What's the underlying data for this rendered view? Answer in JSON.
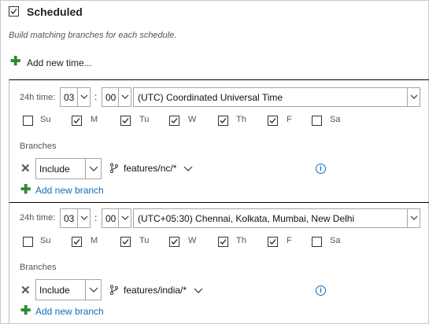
{
  "header": {
    "title": "Scheduled",
    "checked": true,
    "description": "Build matching branches for each schedule.",
    "add_time_label": "Add new time..."
  },
  "schedules": [
    {
      "time_label": "24h time:",
      "hour": "03",
      "minute": "00",
      "separator": ":",
      "timezone": "(UTC) Coordinated Universal Time",
      "days": [
        {
          "label": "Su",
          "checked": false
        },
        {
          "label": "M",
          "checked": true
        },
        {
          "label": "Tu",
          "checked": true
        },
        {
          "label": "W",
          "checked": true
        },
        {
          "label": "Th",
          "checked": true
        },
        {
          "label": "F",
          "checked": true
        },
        {
          "label": "Sa",
          "checked": false
        }
      ],
      "branches_label": "Branches",
      "filter_type": "Include",
      "branch": "features/nc/*",
      "add_branch_label": "Add new branch"
    },
    {
      "time_label": "24h time:",
      "hour": "03",
      "minute": "00",
      "separator": ":",
      "timezone": "(UTC+05:30) Chennai, Kolkata, Mumbai, New Delhi",
      "days": [
        {
          "label": "Su",
          "checked": false
        },
        {
          "label": "M",
          "checked": true
        },
        {
          "label": "Tu",
          "checked": true
        },
        {
          "label": "W",
          "checked": true
        },
        {
          "label": "Th",
          "checked": true
        },
        {
          "label": "F",
          "checked": true
        },
        {
          "label": "Sa",
          "checked": false
        }
      ],
      "branches_label": "Branches",
      "filter_type": "Include",
      "branch": "features/india/*",
      "add_branch_label": "Add new branch"
    }
  ],
  "icons": {
    "check": "checkmark-icon",
    "add": "plus-icon",
    "remove": "close-icon",
    "branch": "git-branch-icon",
    "info": "info-icon",
    "dropdown": "chevron-down-icon"
  },
  "colors": {
    "accent": "#106ebe",
    "add_green": "#2e8b2e"
  }
}
